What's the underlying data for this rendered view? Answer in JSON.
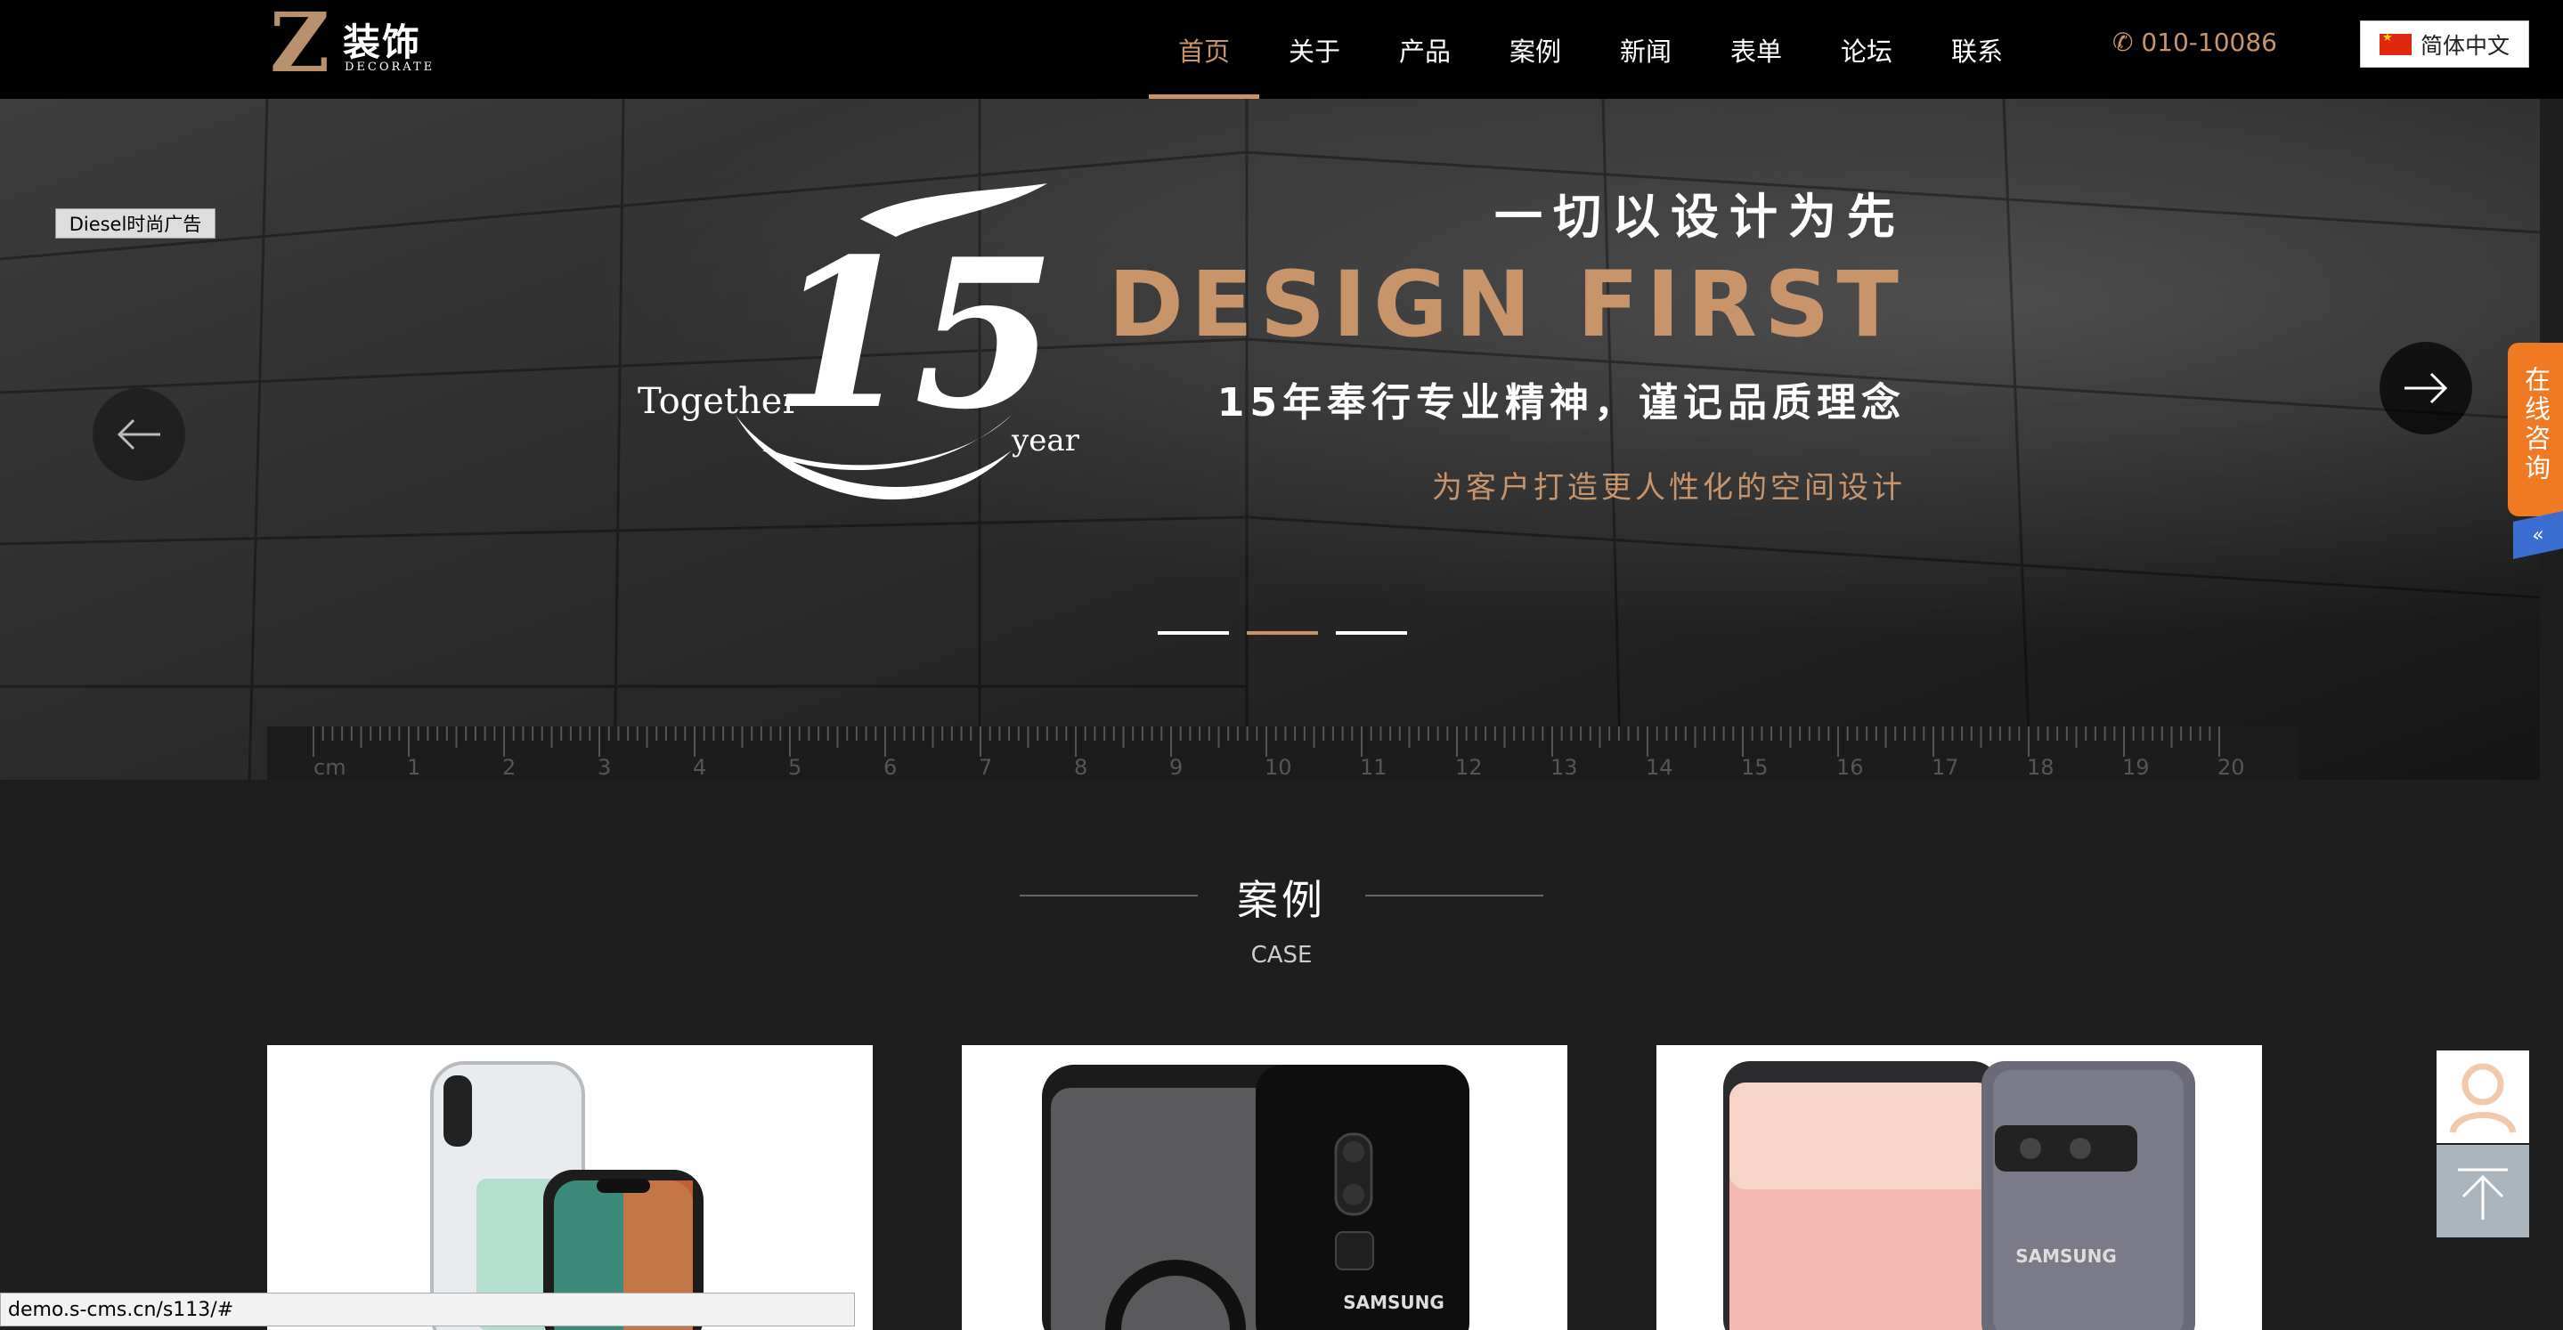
{
  "header": {
    "logo": {
      "letter": "Z",
      "cn": "装饰",
      "en": "DECORATE"
    },
    "nav": [
      {
        "label": "首页",
        "active": true
      },
      {
        "label": "关于",
        "active": false
      },
      {
        "label": "产品",
        "active": false
      },
      {
        "label": "案例",
        "active": false
      },
      {
        "label": "新闻",
        "active": false
      },
      {
        "label": "表单",
        "active": false
      },
      {
        "label": "论坛",
        "active": false
      },
      {
        "label": "联系",
        "active": false
      }
    ],
    "phone": "✆ 010-10086",
    "language": {
      "label": "简体中文",
      "flag_icon": "china-flag-icon"
    }
  },
  "banner": {
    "ad_tag": "Diesel时尚广告",
    "emblem": {
      "number": "15",
      "together": "Together",
      "year": "year"
    },
    "line1": "一切以设计为先",
    "line2": "DESIGN FIRST",
    "line3": "15年奉行专业精神，谨记品质理念",
    "line4": "为客户打造更人性化的空间设计",
    "slides": 3,
    "active_slide": 1,
    "ruler": {
      "unit": "cm",
      "ticks": [
        "1",
        "2",
        "3",
        "4",
        "5",
        "6",
        "7",
        "8",
        "9",
        "10",
        "11",
        "12",
        "13",
        "14",
        "15",
        "16",
        "17",
        "18",
        "19",
        "20"
      ]
    }
  },
  "consult": {
    "label": "在线咨询",
    "toggle": "«"
  },
  "case_section": {
    "title": "案例",
    "subtitle": "CASE",
    "cards": [
      {
        "brand": ""
      },
      {
        "brand": "SAMSUNG"
      },
      {
        "brand": "SAMSUNG"
      }
    ]
  },
  "status_url": "demo.s-cms.cn/s113/#",
  "colors": {
    "accent": "#c8956b",
    "header_bg": "#000000",
    "section_bg": "#1e1e1e",
    "consult": "#f07a23"
  }
}
